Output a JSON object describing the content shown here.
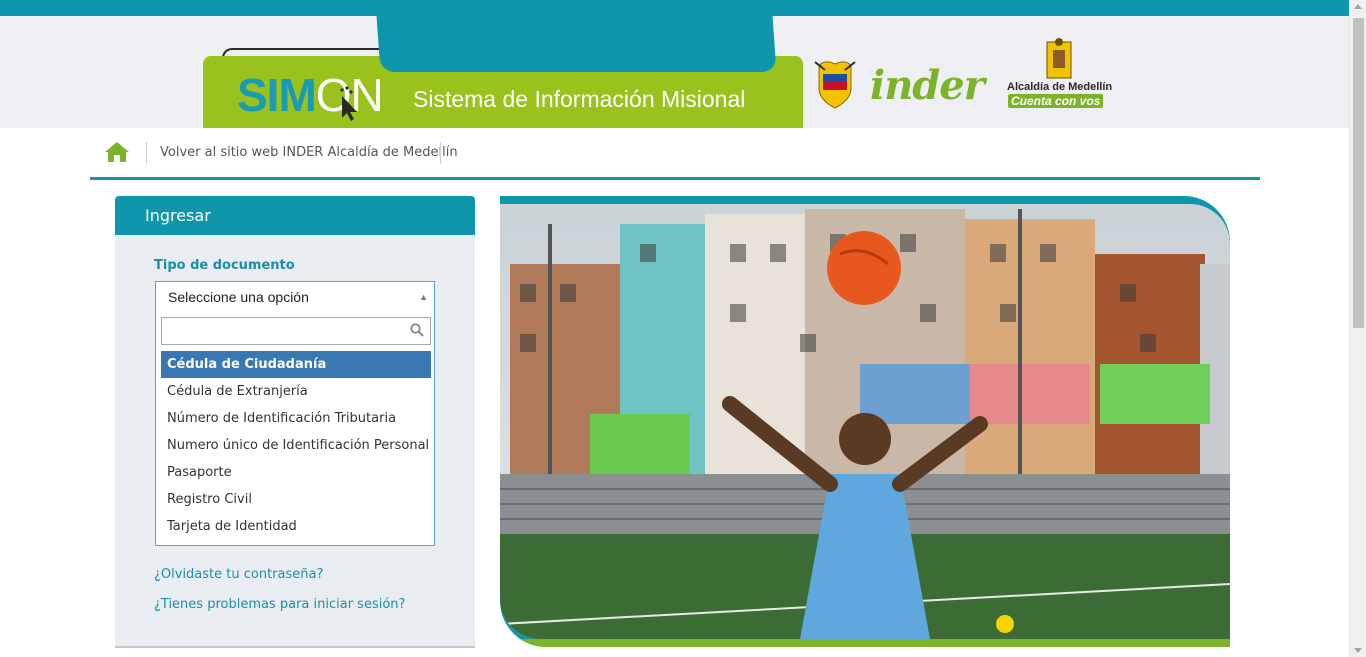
{
  "header": {
    "logo_sim": "SIM",
    "logo_on": "ON",
    "title": "Sistema de Información Misional",
    "partner_inder": "inder",
    "alcaldia_name": "Alcaldía de Medellín",
    "alcaldia_tagline": "Cuenta con vos"
  },
  "breadcrumb": {
    "home_icon": "home-icon",
    "back_link": "Volver al sitio web INDER Alcaldía de Medellín"
  },
  "login": {
    "heading": "Ingresar",
    "doc_type_label": "Tipo de documento",
    "select_value": "Seleccione una opción",
    "search_value": "",
    "options": [
      "Cédula de Ciudadanía",
      "Cédula de Extranjería",
      "Número de Identificación Tributaria",
      "Numero único de Identificación Personal",
      "Pasaporte",
      "Registro Civil",
      "Tarjeta de Identidad"
    ],
    "forgot_password": "¿Olvidaste tu contraseña?",
    "login_problems": "¿Tienes problemas para iniciar sesión?"
  },
  "colors": {
    "teal": "#0f96ad",
    "green": "#99c21c",
    "selected": "#3a78b4"
  }
}
